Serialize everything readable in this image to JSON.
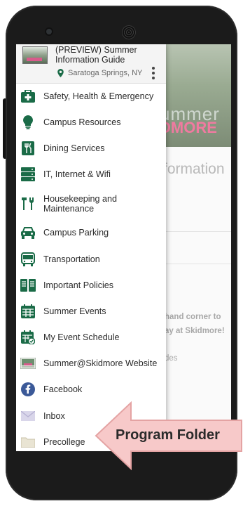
{
  "drawer": {
    "title": "(PREVIEW) Summer Information Guide",
    "location": "Saratoga Springs, NY",
    "items": [
      {
        "label": "Safety, Health & Emergency",
        "icon": "first-aid-icon"
      },
      {
        "label": "Campus Resources",
        "icon": "lightbulb-icon"
      },
      {
        "label": "Dining Services",
        "icon": "dining-icon"
      },
      {
        "label": "IT, Internet & Wifi",
        "icon": "server-icon"
      },
      {
        "label": "Housekeeping and Maintenance",
        "icon": "tools-icon"
      },
      {
        "label": "Campus Parking",
        "icon": "car-icon"
      },
      {
        "label": "Transportation",
        "icon": "bus-icon"
      },
      {
        "label": "Important Policies",
        "icon": "book-icon"
      },
      {
        "label": "Summer Events",
        "icon": "calendar-icon"
      },
      {
        "label": "My Event Schedule",
        "icon": "calendar-check-icon"
      },
      {
        "label": "Summer@Skidmore Website",
        "icon": "website-icon"
      },
      {
        "label": "Facebook",
        "icon": "facebook-icon"
      },
      {
        "label": "Inbox",
        "icon": "envelope-icon"
      },
      {
        "label": "Precollege",
        "icon": "folder-icon"
      }
    ]
  },
  "background": {
    "banner_word1": "ummer",
    "banner_word2": "DMORE",
    "heading": "formation",
    "line1": "hand corner to",
    "line2": "ay at Skidmore!",
    "line3": "des"
  },
  "callout": {
    "label": "Program Folder"
  },
  "colors": {
    "accent": "#1a6b47",
    "arrow": "#f7c9c9",
    "arrow_stroke": "#e4a3a3",
    "facebook": "#3b5998"
  }
}
